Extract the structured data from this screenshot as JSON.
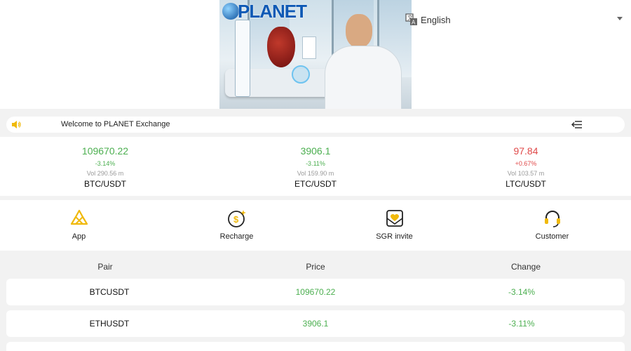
{
  "header": {
    "brand": "PLANET",
    "language": "English"
  },
  "notice": {
    "text": "Welcome to PLANET Exchange"
  },
  "tickers": [
    {
      "price": "109670.22",
      "change": "-3.14%",
      "volume": "Vol 290.56 m",
      "pair": "BTC/USDT",
      "trend": "green"
    },
    {
      "price": "3906.1",
      "change": "-3.11%",
      "volume": "Vol 159.90 m",
      "pair": "ETC/USDT",
      "trend": "green"
    },
    {
      "price": "97.84",
      "change": "+0.67%",
      "volume": "Vol 103.57 m",
      "pair": "LTC/USDT",
      "trend": "red"
    }
  ],
  "quicknav": [
    {
      "label": "App",
      "icon": "app-icon"
    },
    {
      "label": "Recharge",
      "icon": "recharge-icon"
    },
    {
      "label": "SGR invite",
      "icon": "invite-icon"
    },
    {
      "label": "Customer",
      "icon": "headset-icon"
    }
  ],
  "market": {
    "columns": [
      "Pair",
      "Price",
      "Change"
    ],
    "rows": [
      {
        "pair": "BTCUSDT",
        "price": "109670.22",
        "change": "-3.14%"
      },
      {
        "pair": "ETHUSDT",
        "price": "3906.1",
        "change": "-3.11%"
      }
    ]
  },
  "colors": {
    "up_green": "#4caf50",
    "down_red": "#e04a4a",
    "accent_gold": "#f0b90b"
  }
}
